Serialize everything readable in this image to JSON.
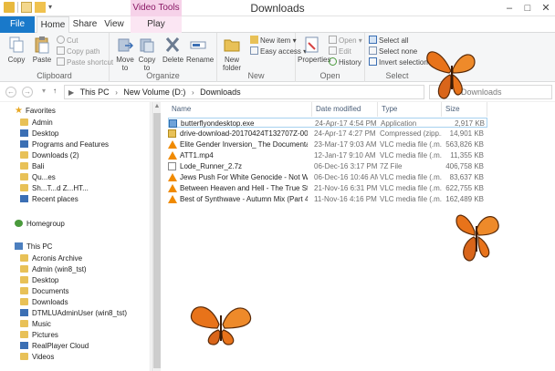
{
  "window": {
    "title": "Downloads",
    "contextual_tab": "Video Tools",
    "minimize": "–",
    "maximize": "□",
    "close": "✕"
  },
  "tabs": [
    "File",
    "Home",
    "Share",
    "View",
    "Play"
  ],
  "ribbon": {
    "clipboard": {
      "label": "Clipboard",
      "copy": "Copy",
      "paste": "Paste",
      "cut": "Cut",
      "copy_path": "Copy path",
      "paste_shortcut": "Paste shortcut"
    },
    "organize": {
      "label": "Organize",
      "move_to": "Move to",
      "copy_to": "Copy to",
      "delete": "Delete",
      "rename": "Rename"
    },
    "new": {
      "label": "New",
      "new_folder": "New folder",
      "new_item": "New item",
      "easy_access": "Easy access"
    },
    "open": {
      "label": "Open",
      "properties": "Properties",
      "open": "Open",
      "edit": "Edit",
      "history": "History"
    },
    "select": {
      "label": "Select",
      "select_all": "Select all",
      "select_none": "Select none",
      "invert_selection": "Invert selection"
    }
  },
  "address": {
    "crumbs": [
      "This PC",
      "New Volume (D:)",
      "Downloads"
    ],
    "search_placeholder": "Downloads"
  },
  "navpane": {
    "favorites": "Favorites",
    "favorite_items": [
      "Admin",
      "Desktop",
      "Programs and Features",
      "Downloads (2)",
      "Bali",
      "Qu...es",
      "Sh...T...d Z...HT...",
      "Recent places"
    ],
    "homegroup": "Homegroup",
    "this_pc": "This PC",
    "pc_items": [
      "Acronis Archive",
      "Admin (win8_tst)",
      "Desktop",
      "Documents",
      "Downloads",
      "DTMLUAdminUser (win8_tst)",
      "Music",
      "Pictures",
      "RealPlayer Cloud",
      "Videos"
    ]
  },
  "columns": {
    "name": "Name",
    "date": "Date modified",
    "type": "Type",
    "size": "Size"
  },
  "files": [
    {
      "name": "butterflyondesktop.exe",
      "date": "24-Apr-17 4:54 PM",
      "type": "Application",
      "size": "2,917 KB",
      "icon": "app-icon"
    },
    {
      "name": "drive-download-20170424T132707Z-001...",
      "date": "24-Apr-17 4:27 PM",
      "type": "Compressed (zipp...",
      "size": "14,901 KB",
      "icon": "zip-icon"
    },
    {
      "name": "Elite Gender Inversion_ The Documentary...",
      "date": "23-Mar-17 9:03 AM",
      "type": "VLC media file (.m...",
      "size": "563,826 KB",
      "icon": "vlc-icon"
    },
    {
      "name": "ATT1.mp4",
      "date": "12-Jan-17 9:10 AM",
      "type": "VLC media file (.m...",
      "size": "11,355 KB",
      "icon": "vlc-icon"
    },
    {
      "name": "Lode_Runner_2.7z",
      "date": "06-Dec-16 3:17 PM",
      "type": "7Z File",
      "size": "406,758 KB",
      "icon": "archive-icon"
    },
    {
      "name": "Jews Push For White Genocide - Not Whi...",
      "date": "06-Dec-16 10:46 AM",
      "type": "VLC media file (.m...",
      "size": "83,637 KB",
      "icon": "vlc-icon"
    },
    {
      "name": "Between Heaven and Hell - The True Stor...",
      "date": "21-Nov-16 6:31 PM",
      "type": "VLC media file (.m...",
      "size": "622,755 KB",
      "icon": "vlc-icon"
    },
    {
      "name": "Best of Synthwave - Autumn Mix (Part 4)...",
      "date": "11-Nov-16 4:16 PM",
      "type": "VLC media file (.m...",
      "size": "162,489 KB",
      "icon": "vlc-icon"
    }
  ],
  "colors": {
    "file_tab": "#1979ca",
    "butterfly": "#e8731a",
    "selection_border": "#a7d1f0"
  }
}
